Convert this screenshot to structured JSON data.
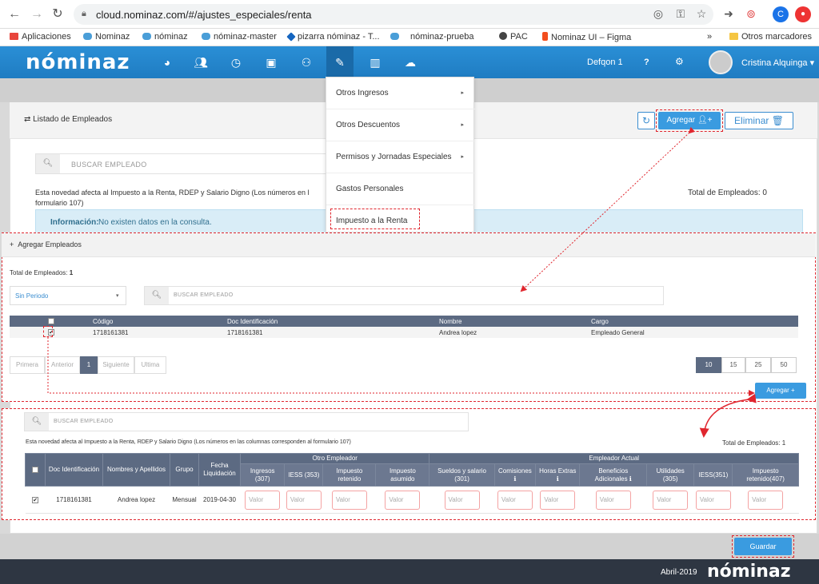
{
  "browser": {
    "url": "cloud.nominaz.com/#/ajustes_especiales/renta",
    "bookmarks": [
      "Aplicaciones",
      "Nominaz",
      "nóminaz",
      "nóminaz-master",
      "pizarra nóminaz - T...",
      "nóminaz-prueba",
      "PAC",
      "Nominaz UI – Figma"
    ],
    "more": "»",
    "other_bookmarks": "Otros marcadores",
    "profile_initial": "C"
  },
  "header": {
    "logo": "nóminaz",
    "company": "Defqon 1",
    "help": "?",
    "user": "Cristina Alquinga"
  },
  "dropdown": {
    "items": [
      {
        "label": "Otros Ingresos",
        "arrow": "▸"
      },
      {
        "label": "Otros Descuentos",
        "arrow": "▸"
      },
      {
        "label": "Permisos y Jornadas Especiales",
        "arrow": "▸"
      },
      {
        "label": "Gastos Personales",
        "arrow": ""
      },
      {
        "label": "Impuesto a la Renta",
        "arrow": ""
      }
    ]
  },
  "list": {
    "title": "⇄ Listado de Empleados",
    "add_label": "Agregar",
    "delete_label": "Eliminar",
    "search_placeholder": "BUSCAR EMPLEADO",
    "note_line1": "Esta novedad afecta al Impuesto a la Renta, RDEP y Salario Digno (Los números en l",
    "note_line2": "formulario 107)",
    "total_label": "Total de Empleados: 0",
    "info_title": "Información:",
    "info_text": "No existen datos en la consulta."
  },
  "agregar": {
    "title": "Agregar Empleados",
    "total_label": "Total de Empleados:",
    "total_value": "1",
    "period": "Sin Periodo",
    "search_placeholder": "BUSCAR EMPLEADO",
    "columns": [
      "Código",
      "Doc Identificación",
      "Nombre",
      "Cargo"
    ],
    "rows": [
      {
        "codigo": "1718161381",
        "doc": "1718161381",
        "nombre": "Andrea lopez",
        "cargo": "Empleado General"
      }
    ],
    "pager": [
      "Primera",
      "Anterior",
      "1",
      "Siguiente",
      "Ultima"
    ],
    "sizes": [
      "10",
      "15",
      "25",
      "50"
    ],
    "add_label": "Agregar",
    "check_mark": "✔"
  },
  "renta": {
    "search_placeholder": "BUSCAR EMPLEADO",
    "note": "Esta novedad afecta al Impuesto a la Renta, RDEP y Salario Digno (Los números en las columnas corresponden al formulario 107)",
    "total_label": "Total de Empleados: 1",
    "group_otro": "Otro Empleador",
    "group_actual": "Empleador Actual",
    "cols_base": [
      "Doc Identificación",
      "Nombres y Apellidos",
      "Grupo",
      "Fecha Liquidación"
    ],
    "cols_otro": [
      "Ingresos (307)",
      "IESS (353)",
      "Impuesto retenido",
      "Impuesto asumido"
    ],
    "cols_actual": [
      "Sueldos y salario (301)",
      "Comisiones ℹ",
      "Horas Extras ℹ",
      "Beneficios Adicionales ℹ",
      "Utilidades (305)",
      "IESS(351)",
      "Impuesto retenido(407)"
    ],
    "row": {
      "doc": "1718161381",
      "nombre": "Andrea lopez",
      "grupo": "Mensual",
      "fecha": "2019-04-30",
      "check": "✔"
    },
    "valor_placeholder": "Valor",
    "save_label": "Guardar"
  },
  "footer": {
    "date": "Abril-2019",
    "logo": "nóminaz"
  },
  "colors": {
    "primary": "#2a8fd6",
    "dashed": "#e0262e",
    "table_header": "#5c6a82"
  }
}
